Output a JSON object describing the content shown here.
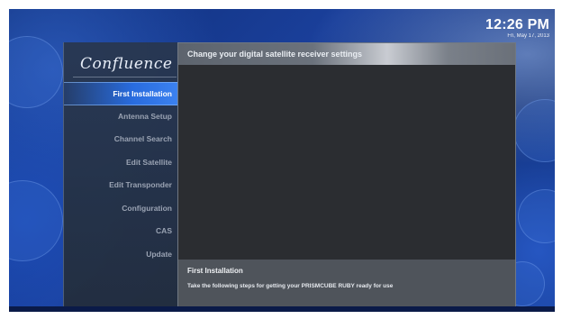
{
  "clock": {
    "time": "12:26 PM",
    "date": "Fri, May 17, 2013"
  },
  "logo": {
    "text": "Confluence"
  },
  "menu": {
    "items": [
      {
        "label": "First Installation",
        "active": true
      },
      {
        "label": "Antenna Setup",
        "active": false
      },
      {
        "label": "Channel Search",
        "active": false
      },
      {
        "label": "Edit Satellite",
        "active": false
      },
      {
        "label": "Edit Transponder",
        "active": false
      },
      {
        "label": "Configuration",
        "active": false
      },
      {
        "label": "CAS",
        "active": false
      },
      {
        "label": "Update",
        "active": false
      }
    ]
  },
  "panel": {
    "header": "Change your digital satellite receiver settings",
    "footer_title": "First Installation",
    "footer_desc": "Take the following steps for getting your PRISMCUBE RUBY ready for use"
  },
  "colors": {
    "accent": "#2e6fe0",
    "background": "#143a8e",
    "panel": "#2b2d31"
  }
}
